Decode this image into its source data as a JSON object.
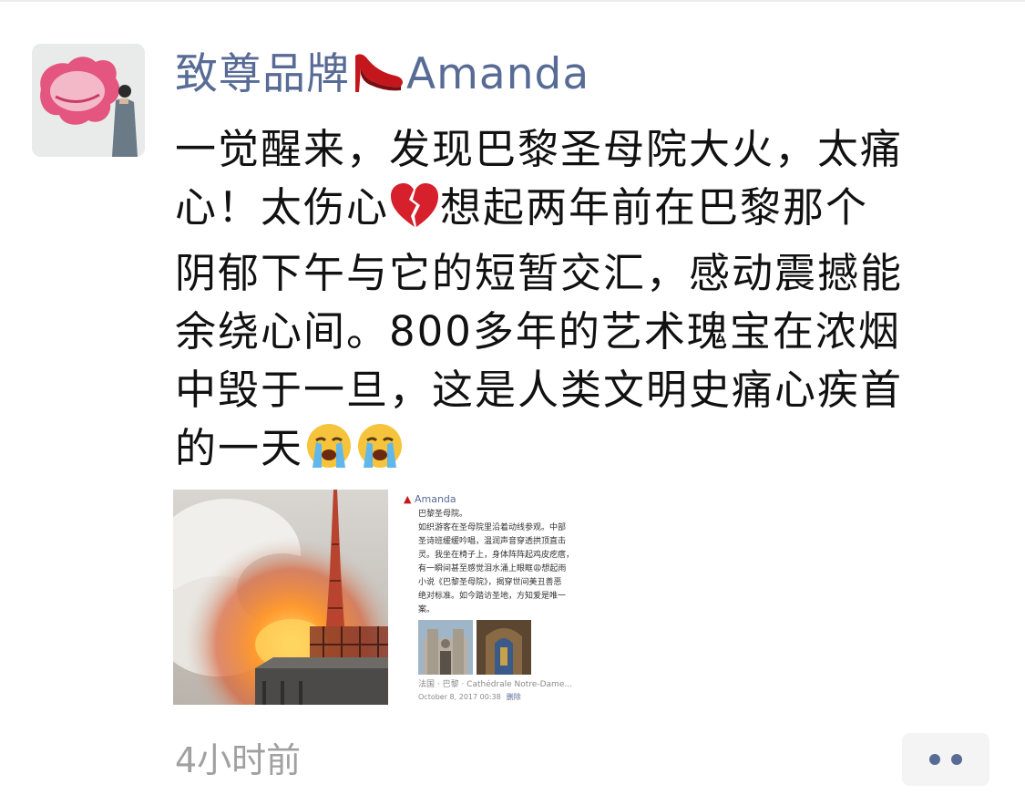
{
  "post": {
    "author_name_prefix": "致尊品牌",
    "author_name_suffix": "Amanda",
    "author_emoji": "high-heel-icon",
    "content_lines": [
      "一觉醒来，发现巴黎圣母院大火，太痛",
      "心！太伤心",
      "想起两年前在巴黎那个",
      "阴郁下午与它的短暂交汇，感动震撼能",
      "余绕心间。800多年的艺术瑰宝在浓烟",
      "中毁于一旦，这是人类文明史痛心疾首",
      "的一天"
    ],
    "inline_emojis": [
      "broken-heart-icon",
      "loudly-crying-face-icon",
      "loudly-crying-face-icon"
    ],
    "time": "4小时前",
    "link_color": "#576b95"
  },
  "images": {
    "photo1": "notre-dame-fire-photo",
    "photo2": {
      "header": "Amanda",
      "text": "巴黎圣母院。\n如织游客在圣母院里沿着动线参观。中部\n圣诗班缓缓吟唱，温润声音穿透拱顶直击\n灵。我坐在椅子上，身体阵阵起鸡皮疙瘩，\n有一瞬间甚至感觉泪水涌上眼眶😩想起雨\n小说《巴黎圣母院》，揭穿世间美丑善恶\n绝对标准。如今踏访圣地，方知爱是唯一\n案。",
      "location": "法国 · 巴黎 · Cathédrale Notre-Dame...",
      "date": "October 8, 2017 00:38",
      "delete_label": "删除"
    }
  }
}
